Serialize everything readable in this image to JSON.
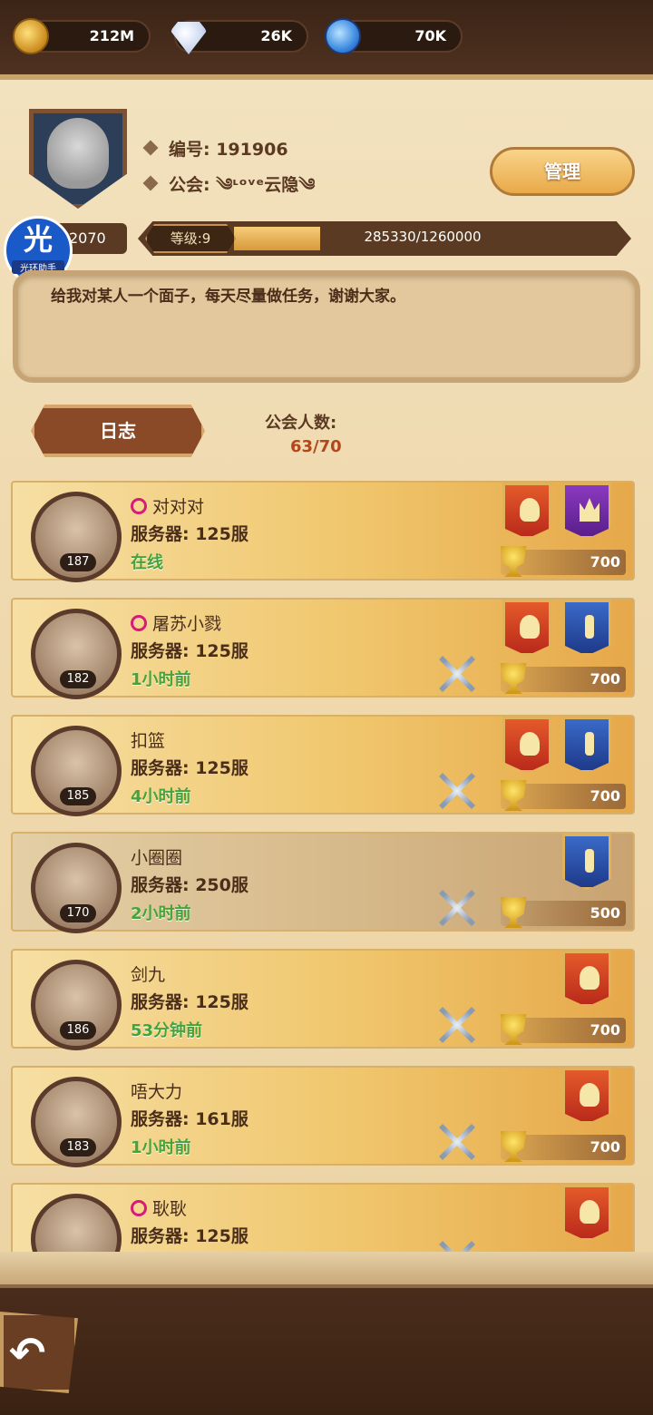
{
  "resources": [
    {
      "icon": "gold-coin-icon",
      "value": "212M"
    },
    {
      "icon": "diamond-icon",
      "value": "26K"
    },
    {
      "icon": "blue-crystal-icon",
      "value": "70K"
    }
  ],
  "profile": {
    "id_label": "编号: 191906",
    "guild_label": "公会: ༄ᶫᵒᵛᵉ云隐༄",
    "manage_label": "管理",
    "left_value": "2070",
    "level_label": "等级:9",
    "exp_text": "285330/1260000",
    "exp_progress": 0.2264,
    "motto": "给我对某人一个面子，每天尽量做任务，谢谢大家。"
  },
  "watermark": {
    "big": "光",
    "small": "光环助手"
  },
  "actions": {
    "log_label": "日志"
  },
  "members_info": {
    "label": "公会人数:",
    "count": "63/70"
  },
  "members": [
    {
      "name": "对对对",
      "female": true,
      "server": "服务器: 125服",
      "status": "在线",
      "level": "187",
      "score": "700",
      "banners": [
        "red",
        "purple"
      ],
      "swords": false
    },
    {
      "name": "屠苏小戮",
      "female": true,
      "server": "服务器: 125服",
      "status": "1小时前",
      "level": "182",
      "score": "700",
      "banners": [
        "red",
        "blue"
      ],
      "swords": true
    },
    {
      "name": "扣篮",
      "female": false,
      "server": "服务器: 125服",
      "status": "4小时前",
      "level": "185",
      "score": "700",
      "banners": [
        "red",
        "blue"
      ],
      "swords": true
    },
    {
      "name": "小圈圈",
      "female": false,
      "server": "服务器: 250服",
      "status": "2小时前",
      "level": "170",
      "score": "500",
      "banners": [
        "blue"
      ],
      "swords": true,
      "dim": true
    },
    {
      "name": "剑九",
      "female": false,
      "server": "服务器: 125服",
      "status": "53分钟前",
      "level": "186",
      "score": "700",
      "banners": [
        "red"
      ],
      "swords": true
    },
    {
      "name": "唔大力",
      "female": false,
      "server": "服务器: 161服",
      "status": "1小时前",
      "level": "183",
      "score": "700",
      "banners": [
        "red"
      ],
      "swords": true
    },
    {
      "name": "耿耿",
      "female": true,
      "server": "服务器: 125服",
      "status": "",
      "level": "",
      "score": "",
      "banners": [
        "red"
      ],
      "swords": true
    }
  ],
  "nav": {
    "back_label": "↶"
  }
}
